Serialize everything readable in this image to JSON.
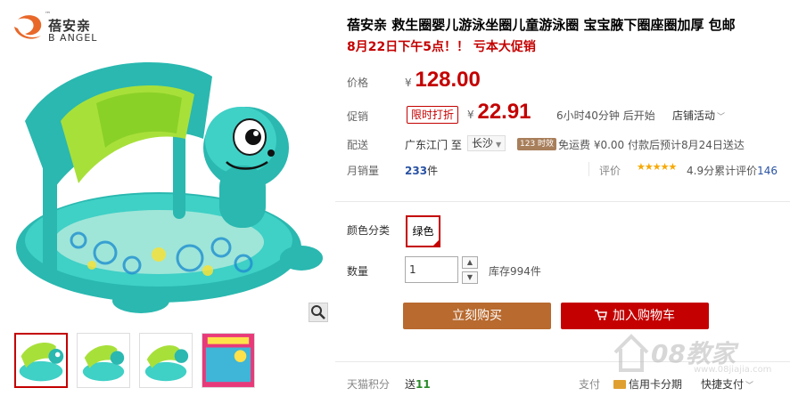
{
  "brand": {
    "name_cn": "蓓安亲",
    "name_en": "B ANGEL",
    "tm": "™"
  },
  "product": {
    "title": "蓓安亲 救生圈婴儿游泳坐圈儿童游泳圈 宝宝腋下圈座圈加厚 包邮",
    "promo_line": "8月22日下午5点！！ 亏本大促销"
  },
  "price": {
    "label": "价格",
    "currency": "¥",
    "original": "128.00"
  },
  "promotion": {
    "label": "促销",
    "tag": "限时打折",
    "currency": "¥",
    "price": "22.91",
    "countdown": "6小时40分钟 后开始",
    "store_activity": "店铺活动"
  },
  "shipping": {
    "label": "配送",
    "from": "广东江门 至",
    "to": "长沙",
    "badge": "123 时效",
    "info": "免运费 ¥0.00 付款后预计8月24日送达"
  },
  "sales": {
    "label": "月销量",
    "count": "233",
    "unit": "件",
    "rating_label": "评价",
    "stars": "★★★★★",
    "score": "4.9分",
    "total_label": "累计评价",
    "total_count": "146"
  },
  "options": {
    "color_label": "颜色分类",
    "color_selected": "绿色",
    "qty_label": "数量",
    "qty_value": "1",
    "stock": "库存994件"
  },
  "buttons": {
    "buy_now": "立刻购买",
    "add_cart": "加入购物车"
  },
  "footer": {
    "points_label": "天猫积分",
    "points_prefix": "送",
    "points_value": "11",
    "pay_label": "支付",
    "pay_credit": "信用卡分期",
    "pay_quick": "快捷支付"
  },
  "watermark": {
    "text": "08教家",
    "sub": "www.08jiajia.com"
  },
  "colors": {
    "accent": "#c40000",
    "buy": "#b86a2f",
    "link": "#2952a3",
    "star": "#f7a800"
  }
}
